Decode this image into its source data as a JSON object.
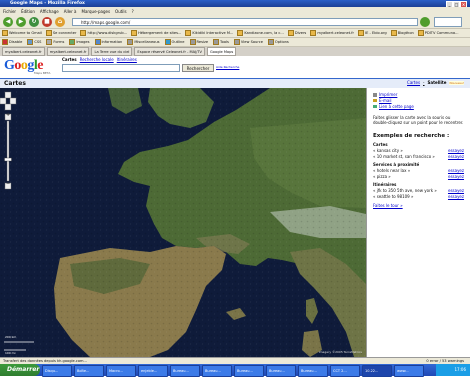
{
  "window": {
    "title": "Google Maps - Mozilla Firefox",
    "min": "_",
    "max": "□",
    "close": "×"
  },
  "menu": [
    "Fichier",
    "Édition",
    "Affichage",
    "Aller à",
    "Marque-pages",
    "Outils",
    "?"
  ],
  "url": "http://maps.google.com/",
  "bookmarks1": [
    "Welcome to Gmail",
    "Se connecter",
    "http://www.diskgrub...",
    "Hébergement de sites...",
    "Kikidiki Interactive M...",
    "Kandizone.com, la c...",
    "Divers",
    "myalbert.celeonet.fr",
    "IE - Ebio.org",
    "Blogthon",
    "PDITV Communa..."
  ],
  "bookmarks2": [
    "Disable",
    "CSS",
    "Forms",
    "Images",
    "Information",
    "Miscellaneous",
    "Outline",
    "Resize",
    "Tools",
    "View Source",
    "Options"
  ],
  "tabs": [
    "myalbert.celeonet.fr",
    "myalbert.celeonet.fr",
    "La Terre vue du ciel",
    "Espace réservé Celeonet.fr - MAJ/TV",
    "Google Maps"
  ],
  "google": {
    "logo": "Google",
    "logo_sub": "Maps BETA",
    "search_tabs": {
      "web": "Web",
      "cartes": "Cartes",
      "local": "Recherche locale",
      "itineraires": "Itinéraires"
    },
    "search_button": "Rechercher",
    "search_link": "Aide Recherche"
  },
  "header": {
    "title": "Cartes",
    "links": [
      "Cartes",
      "Satellite"
    ],
    "beta": "Nouveau!"
  },
  "side": {
    "print": "Imprimer",
    "email": "E-mail",
    "link": "Lien à cette page",
    "intro": "Faites glisser la carte avec la souris ou double-cliquez sur un point pour le recentrer.",
    "examples_title": "Exemples de recherche :",
    "sections": [
      {
        "title": "Cartes",
        "items": [
          [
            "« kansas city »",
            "essayez"
          ],
          [
            "« 10 market st, san francisco »",
            "essayez"
          ]
        ]
      },
      {
        "title": "Services à proximité",
        "items": [
          [
            "« hotels near lax »",
            "essayez"
          ],
          [
            "« pizza »",
            "essayez"
          ]
        ]
      },
      {
        "title": "Itinéraires",
        "items": [
          [
            "« jfk to 350 5th ave, new york »",
            "essayez"
          ],
          [
            "« seattle to 98109 »",
            "essayez"
          ]
        ]
      }
    ],
    "tour": "Faites le tour »"
  },
  "map": {
    "zoom_plus": "+",
    "zoom_minus": "−",
    "scale_top": "200 km",
    "scale_bottom": "100 mi",
    "copyright": "Imagery ©2005 TerraMetrics"
  },
  "status": {
    "left": "Transfert des données depuis kh.google.com...",
    "right": "0 error / 53 warnings"
  },
  "taskbar": {
    "start": "Démarrer",
    "tasks": [
      "Disqu...",
      "Boîte...",
      "Macro...",
      "enjeble...",
      "Bureau...",
      "Bureau...",
      "Bureau...",
      "Bureau...",
      "Bureau...",
      "CCT 2...",
      "10.22...",
      "www..."
    ],
    "clock": "17:06"
  }
}
